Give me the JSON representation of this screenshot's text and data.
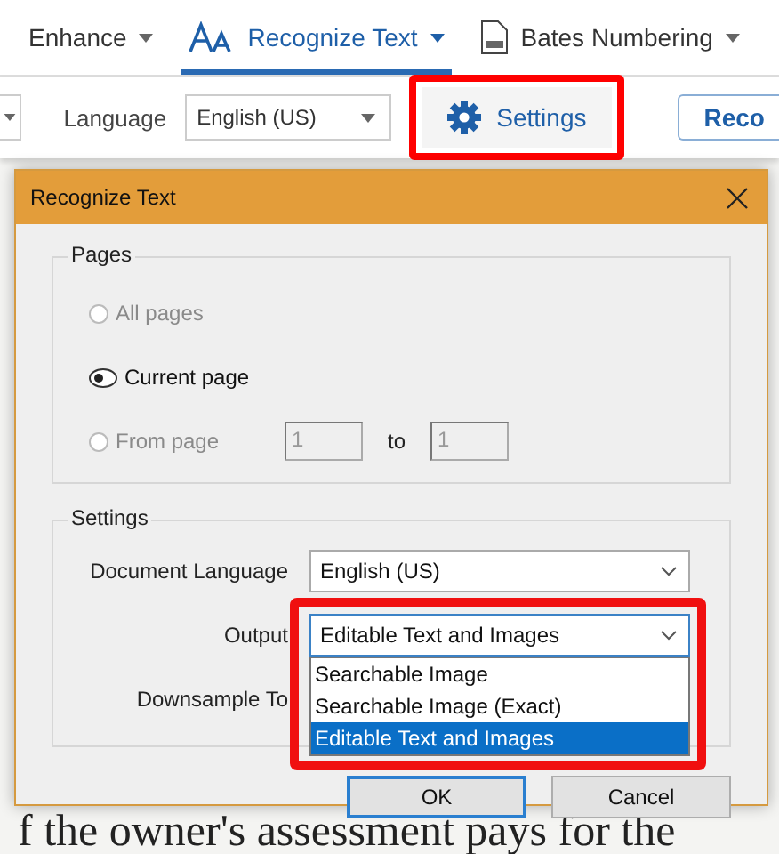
{
  "toolbar": {
    "tabs": [
      {
        "label": "Enhance",
        "selected": false
      },
      {
        "label": "Recognize Text",
        "selected": true
      },
      {
        "label": "Bates Numbering",
        "selected": false
      }
    ]
  },
  "options_bar": {
    "language_label": "Language",
    "language_value": "English (US)",
    "settings_button": {
      "label": "Settings",
      "highlighted": true
    },
    "recognize_button": "Reco"
  },
  "document": {
    "line": "f the owner's assessment pays for the"
  },
  "dialog": {
    "title": "Recognize Text",
    "pages": {
      "title": "Pages",
      "options": [
        {
          "label": "All pages",
          "selected": false,
          "disabled": true
        },
        {
          "label": "Current page",
          "selected": true,
          "disabled": false
        },
        {
          "label": "From page",
          "selected": false,
          "disabled": true
        }
      ],
      "from_value": "1",
      "to_label": "to",
      "to_value": "1"
    },
    "settings": {
      "title": "Settings",
      "language_label": "Document Language",
      "language_value": "English (US)",
      "output_label": "Output",
      "output_value": "Editable Text and Images",
      "output_expanded": true,
      "output_highlighted": true,
      "output_options": [
        {
          "label": "Searchable Image",
          "selected": false
        },
        {
          "label": "Searchable Image (Exact)",
          "selected": false
        },
        {
          "label": "Editable Text and Images",
          "selected": true
        }
      ],
      "downsample_label": "Downsample To"
    },
    "buttons": [
      {
        "label": "OK",
        "default": true
      },
      {
        "label": "Cancel",
        "default": false
      }
    ]
  }
}
